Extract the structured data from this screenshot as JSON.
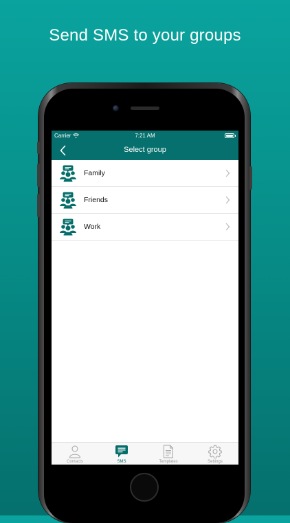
{
  "headline": "Send SMS to your groups",
  "status_bar": {
    "carrier": "Carrier",
    "time": "7:21 AM"
  },
  "nav": {
    "title": "Select group"
  },
  "groups": [
    {
      "label": "Family"
    },
    {
      "label": "Friends"
    },
    {
      "label": "Work"
    }
  ],
  "tabs": [
    {
      "label": "Contacts",
      "icon": "person-icon",
      "active": false
    },
    {
      "label": "SMS",
      "icon": "chat-bubble-icon",
      "active": true
    },
    {
      "label": "Templates",
      "icon": "document-icon",
      "active": false
    },
    {
      "label": "Settings",
      "icon": "gear-icon",
      "active": false
    }
  ],
  "colors": {
    "accent": "#05706d",
    "background_top": "#0aa39e",
    "background_bottom": "#05706d",
    "tab_inactive": "#9a9a9a"
  }
}
